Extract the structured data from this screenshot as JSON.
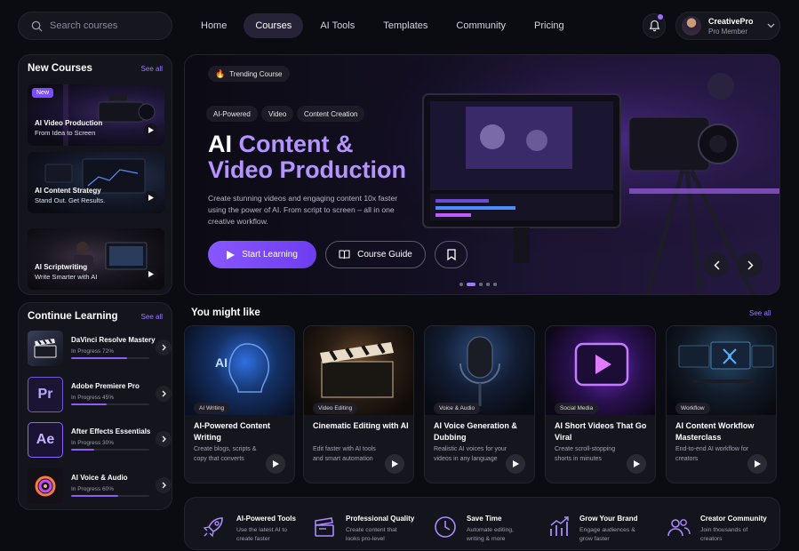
{
  "search": {
    "placeholder": "Search courses"
  },
  "nav": [
    {
      "label": "Home",
      "active": false
    },
    {
      "label": "Courses",
      "active": true
    },
    {
      "label": "AI Tools",
      "active": false
    },
    {
      "label": "Templates",
      "active": false
    },
    {
      "label": "Community",
      "active": false
    },
    {
      "label": "Pricing",
      "active": false
    }
  ],
  "profile": {
    "name": "CreativePro",
    "role": "Pro Member"
  },
  "new_courses": {
    "title": "New Courses",
    "see_all": "See all",
    "items": [
      {
        "badge": "New",
        "title": "AI Video Production",
        "subtitle": "From Idea to Screen"
      },
      {
        "title": "AI Content Strategy",
        "subtitle": "Stand Out. Get Results."
      },
      {
        "title": "AI Scriptwriting",
        "subtitle": "Write Smarter with AI"
      }
    ]
  },
  "continue_learning": {
    "title": "Continue Learning",
    "see_all": "See all",
    "items": [
      {
        "title": "DaVinci Resolve Mastery",
        "progress_text": "In Progress 72%",
        "progress": 0.72
      },
      {
        "title": "Adobe Premiere Pro",
        "progress_text": "In Progress 45%",
        "progress": 0.45,
        "icon_text": "Pr"
      },
      {
        "title": "After Effects Essentials",
        "progress_text": "In Progress 30%",
        "progress": 0.3,
        "icon_text": "Ae"
      },
      {
        "title": "AI Voice & Audio",
        "progress_text": "In Progress 60%",
        "progress": 0.6
      }
    ]
  },
  "hero": {
    "badge": "Trending Course",
    "chips": [
      "AI-Powered",
      "Video",
      "Content Creation"
    ],
    "title_white_1": "AI",
    "title_purple_1": "Content &",
    "title_purple_2": "Video",
    "title_white_2": "Production",
    "description": "Create stunning videos and engaging content 10x faster using the power of AI. From script to screen – all in one creative workflow.",
    "primary_button": "Start Learning",
    "secondary_button": "Course Guide",
    "slides": 5,
    "active_slide": 2
  },
  "you_might_like": {
    "title": "You might like",
    "see_all": "See all",
    "items": [
      {
        "tag": "AI Writing",
        "title": "AI-Powered Content Writing",
        "desc": "Create blogs, scripts & copy that converts"
      },
      {
        "tag": "Video Editing",
        "title": "Cinematic Editing with AI",
        "desc": "Edit faster with AI tools and smart automation"
      },
      {
        "tag": "Voice & Audio",
        "title": "AI Voice Generation & Dubbing",
        "desc": "Realistic AI voices for your videos in any language"
      },
      {
        "tag": "Social Media",
        "title": "AI Short Videos That Go Viral",
        "desc": "Create scroll-stopping shorts in minutes"
      },
      {
        "tag": "Workflow",
        "title": "AI Content Workflow Masterclass",
        "desc": "End-to-end AI workflow for creators"
      }
    ]
  },
  "features": [
    {
      "icon": "rocket-icon",
      "title": "AI-Powered Tools",
      "desc": "Use the latest AI to create faster"
    },
    {
      "icon": "clapper-icon",
      "title": "Professional Quality",
      "desc": "Create content that looks pro-level"
    },
    {
      "icon": "clock-icon",
      "title": "Save Time",
      "desc": "Automate editing, writing & more"
    },
    {
      "icon": "chart-icon",
      "title": "Grow Your Brand",
      "desc": "Engage audiences & grow faster"
    },
    {
      "icon": "users-icon",
      "title": "Creator Community",
      "desc": "Join thousands of creators"
    }
  ],
  "colors": {
    "accent": "#8b5cf6",
    "accent_light": "#b494ff",
    "background": "#0b0b12"
  }
}
